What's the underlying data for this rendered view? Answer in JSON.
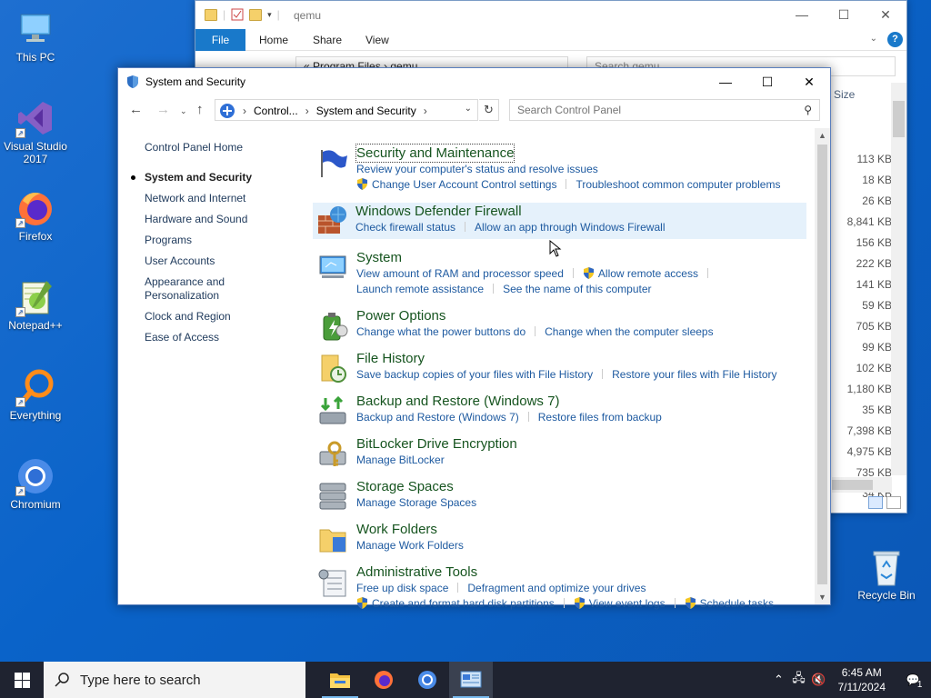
{
  "desktop": {
    "icons": [
      {
        "label": "This PC",
        "icon": "this-pc-icon"
      },
      {
        "label": "Visual Studio 2017",
        "icon": "visual-studio-icon"
      },
      {
        "label": "Firefox",
        "icon": "firefox-icon"
      },
      {
        "label": "Notepad++",
        "icon": "notepadpp-icon"
      },
      {
        "label": "Everything",
        "icon": "everything-icon"
      },
      {
        "label": "Chromium",
        "icon": "chromium-icon"
      },
      {
        "label": "Recycle Bin",
        "icon": "recycle-bin-icon"
      }
    ]
  },
  "explorer": {
    "title": "qemu",
    "ribbon_tabs": [
      "File",
      "Home",
      "Share",
      "View"
    ],
    "address": [
      "Program Files",
      "qemu"
    ],
    "search_placeholder": "Search qemu",
    "column_header": "Size",
    "sizes": [
      "113 KB",
      "18 KB",
      "26 KB",
      "8,841 KB",
      "156 KB",
      "222 KB",
      "141 KB",
      "59 KB",
      "705 KB",
      "99 KB",
      "102 KB",
      "1,180 KB",
      "35 KB",
      "7,398 KB",
      "4,975 KB",
      "735 KB",
      "34 KB"
    ]
  },
  "cp": {
    "title": "System and Security",
    "breadcrumbs": [
      "Control...",
      "System and Security"
    ],
    "search_placeholder": "Search Control Panel",
    "leftnav": {
      "home": "Control Panel Home",
      "current": "System and Security",
      "items": [
        "Network and Internet",
        "Hardware and Sound",
        "Programs",
        "User Accounts",
        "Appearance and Personalization",
        "Clock and Region",
        "Ease of Access"
      ]
    },
    "categories": [
      {
        "heading": "Security and Maintenance",
        "links": [
          "Review your computer's status and resolve issues",
          "Change User Account Control settings",
          "Troubleshoot common computer problems"
        ]
      },
      {
        "heading": "Windows Defender Firewall",
        "links": [
          "Check firewall status",
          "Allow an app through Windows Firewall"
        ]
      },
      {
        "heading": "System",
        "links": [
          "View amount of RAM and processor speed",
          "Allow remote access",
          "Launch remote assistance",
          "See the name of this computer"
        ]
      },
      {
        "heading": "Power Options",
        "links": [
          "Change what the power buttons do",
          "Change when the computer sleeps"
        ]
      },
      {
        "heading": "File History",
        "links": [
          "Save backup copies of your files with File History",
          "Restore your files with File History"
        ]
      },
      {
        "heading": "Backup and Restore (Windows 7)",
        "links": [
          "Backup and Restore (Windows 7)",
          "Restore files from backup"
        ]
      },
      {
        "heading": "BitLocker Drive Encryption",
        "links": [
          "Manage BitLocker"
        ]
      },
      {
        "heading": "Storage Spaces",
        "links": [
          "Manage Storage Spaces"
        ]
      },
      {
        "heading": "Work Folders",
        "links": [
          "Manage Work Folders"
        ]
      },
      {
        "heading": "Administrative Tools",
        "links": [
          "Free up disk space",
          "Defragment and optimize your drives",
          "Create and format hard disk partitions",
          "View event logs",
          "Schedule tasks"
        ]
      }
    ]
  },
  "taskbar": {
    "search_placeholder": "Type here to search",
    "time": "6:45 AM",
    "date": "7/11/2024",
    "notification_count": "1"
  }
}
